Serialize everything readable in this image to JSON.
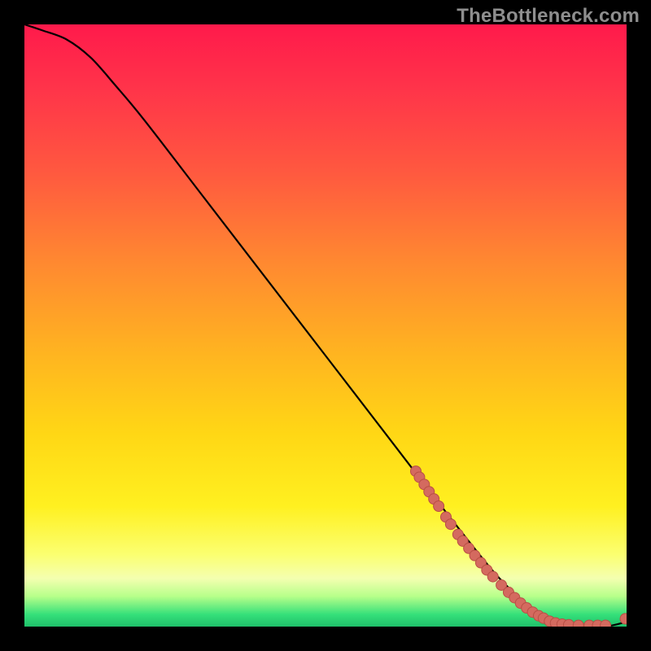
{
  "watermark": "TheBottleneck.com",
  "colors": {
    "background": "#000000",
    "curve_stroke": "#000000",
    "point_fill": "#d46a5f",
    "point_stroke": "#b94f45",
    "gradient_top": "#ff1a4b",
    "gradient_bottom": "#1fc06a"
  },
  "chart_data": {
    "type": "line",
    "title": "",
    "xlabel": "",
    "ylabel": "",
    "xlim": [
      0,
      100
    ],
    "ylim": [
      0,
      100
    ],
    "series": [
      {
        "name": "curve",
        "x": [
          0,
          3,
          7,
          11,
          15,
          20,
          30,
          40,
          50,
          60,
          70,
          78,
          83,
          86,
          90,
          94,
          97,
          100
        ],
        "y": [
          100,
          99,
          97.5,
          94.5,
          90,
          84,
          71,
          58,
          45,
          32,
          19,
          9,
          4,
          1.5,
          0.5,
          0.2,
          0.1,
          0.8
        ]
      }
    ],
    "points": [
      {
        "x": 65.0,
        "y": 25.8
      },
      {
        "x": 65.6,
        "y": 24.8
      },
      {
        "x": 66.4,
        "y": 23.6
      },
      {
        "x": 67.2,
        "y": 22.4
      },
      {
        "x": 68.0,
        "y": 21.2
      },
      {
        "x": 68.8,
        "y": 20.0
      },
      {
        "x": 70.0,
        "y": 18.2
      },
      {
        "x": 70.8,
        "y": 17.0
      },
      {
        "x": 72.0,
        "y": 15.3
      },
      {
        "x": 72.8,
        "y": 14.2
      },
      {
        "x": 73.8,
        "y": 13.0
      },
      {
        "x": 74.8,
        "y": 11.8
      },
      {
        "x": 75.8,
        "y": 10.6
      },
      {
        "x": 76.8,
        "y": 9.4
      },
      {
        "x": 77.8,
        "y": 8.3
      },
      {
        "x": 79.2,
        "y": 6.9
      },
      {
        "x": 80.4,
        "y": 5.7
      },
      {
        "x": 81.4,
        "y": 4.8
      },
      {
        "x": 82.4,
        "y": 3.9
      },
      {
        "x": 83.4,
        "y": 3.1
      },
      {
        "x": 84.4,
        "y": 2.4
      },
      {
        "x": 85.4,
        "y": 1.8
      },
      {
        "x": 86.2,
        "y": 1.4
      },
      {
        "x": 87.2,
        "y": 0.9
      },
      {
        "x": 88.2,
        "y": 0.6
      },
      {
        "x": 89.3,
        "y": 0.4
      },
      {
        "x": 90.4,
        "y": 0.3
      },
      {
        "x": 92.0,
        "y": 0.2
      },
      {
        "x": 93.8,
        "y": 0.2
      },
      {
        "x": 95.2,
        "y": 0.2
      },
      {
        "x": 96.5,
        "y": 0.2
      },
      {
        "x": 99.8,
        "y": 1.3
      }
    ]
  }
}
